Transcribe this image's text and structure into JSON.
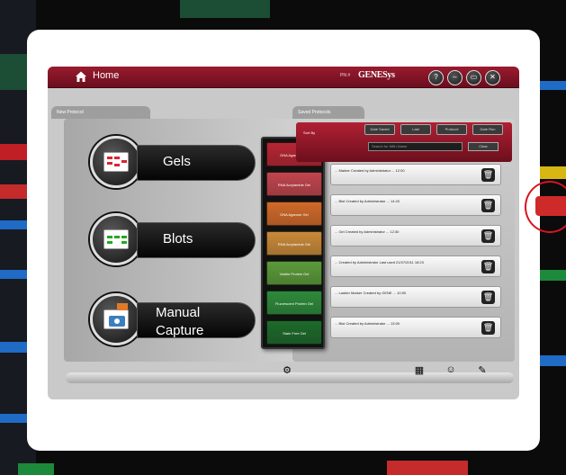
{
  "window": {
    "home_title": "Home",
    "product_code": "PN #",
    "brand": "GENESys",
    "controls": [
      "?",
      "–",
      "▭",
      "✕"
    ]
  },
  "tabs": {
    "new_protocol": "New Protocol",
    "saved_protocols": "Saved Protocols"
  },
  "categories": [
    {
      "label": "Gels",
      "icon": "gel-icon"
    },
    {
      "label": "Blots",
      "icon": "blot-icon"
    },
    {
      "label_line1": "Manual",
      "label_line2": "Capture",
      "icon": "camera-icon"
    }
  ],
  "protocol_menu": [
    {
      "label": "DNA Agarose Gel",
      "color": "#b52634"
    },
    {
      "label": "RNA Acrylamide Gel",
      "color": "#c0454e"
    },
    {
      "label": "DNA Agarose Gel",
      "color": "#d06a2a"
    },
    {
      "label": "RNA Acrylamide Gel",
      "color": "#c98a3a"
    },
    {
      "label": "Visible Protein Gel",
      "color": "#5c9a3a"
    },
    {
      "label": "Fluorescent Protein Gel",
      "color": "#2e8a3b"
    },
    {
      "label": "Stain Free Gel",
      "color": "#1e6a2b"
    }
  ],
  "sort": {
    "label": "Sort By",
    "buttons": [
      "Date Saved",
      "Last",
      "Protocol",
      "Date Run"
    ],
    "search_placeholder": "Search for With Name",
    "search_button": "Clear"
  },
  "saved_protocols": [
    {
      "text": "... Marker   Created by  Administrator  ... 12:00"
    },
    {
      "text": "... Blot   Created by  Administrator  ... 14:20"
    },
    {
      "text": "... Gel   Created by  Administrator  ... 12:30"
    },
    {
      "text": "...   Created by  Administrator   Last used   21/07/2011 18:23"
    },
    {
      "text": "... Ladder Marker   Created by  GENE  ... 10:00"
    },
    {
      "text": "... Blot   Created by  Administrator  ... 13:00"
    }
  ],
  "bottom_tools": [
    "tools-icon",
    "gallery-icon",
    "user-icon",
    "settings-icon"
  ]
}
